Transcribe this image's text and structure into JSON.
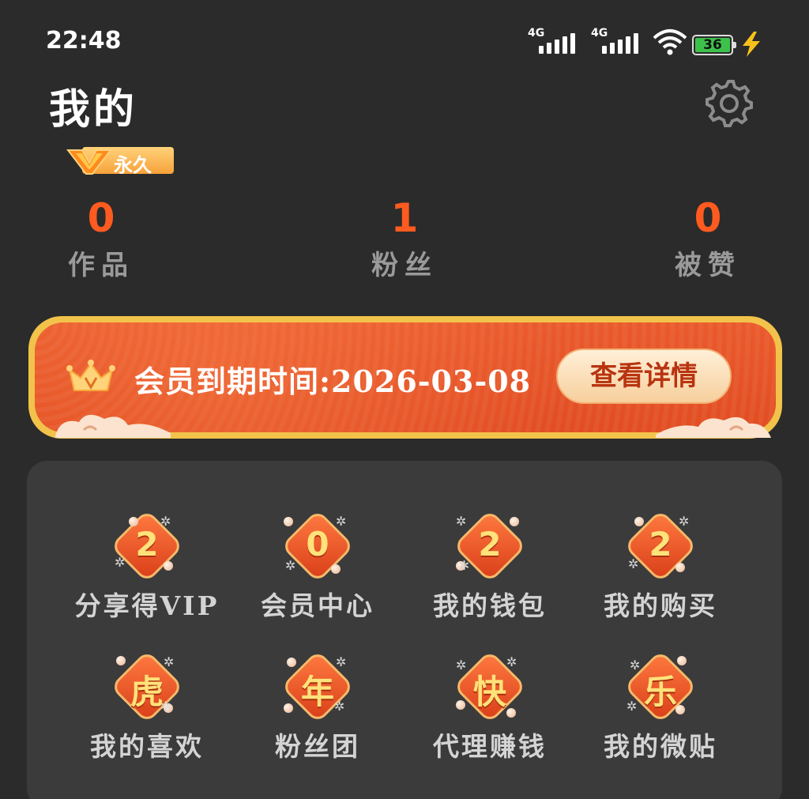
{
  "status_bar": {
    "time": "22:48",
    "network_1": "4G",
    "network_2": "4G",
    "battery": "36"
  },
  "header": {
    "title": "我的",
    "vip_badge": "永久"
  },
  "stats": [
    {
      "value": "0",
      "label": "作品"
    },
    {
      "value": "1",
      "label": "粉丝"
    },
    {
      "value": "0",
      "label": "被赞"
    }
  ],
  "membership": {
    "expire_text": "会员到期时间:2026-03-08",
    "detail_button": "查看详情"
  },
  "menu": [
    {
      "glyph": "2",
      "label": "分享得VIP",
      "icon": "share-icon"
    },
    {
      "glyph": "0",
      "label": "会员中心",
      "icon": "member-center-icon"
    },
    {
      "glyph": "2",
      "label": "我的钱包",
      "icon": "wallet-icon"
    },
    {
      "glyph": "2",
      "label": "我的购买",
      "icon": "purchase-icon"
    },
    {
      "glyph": "虎",
      "label": "我的喜欢",
      "icon": "favorite-icon"
    },
    {
      "glyph": "年",
      "label": "粉丝团",
      "icon": "fan-group-icon"
    },
    {
      "glyph": "快",
      "label": "代理赚钱",
      "icon": "agent-earn-icon"
    },
    {
      "glyph": "乐",
      "label": "我的微贴",
      "icon": "micro-post-icon"
    }
  ],
  "colors": {
    "accent": "#ff5a1f",
    "background": "#2b2b2b",
    "panel": "#3b3b3b",
    "banner": "#e24d22",
    "banner_border": "#f2c34a"
  }
}
